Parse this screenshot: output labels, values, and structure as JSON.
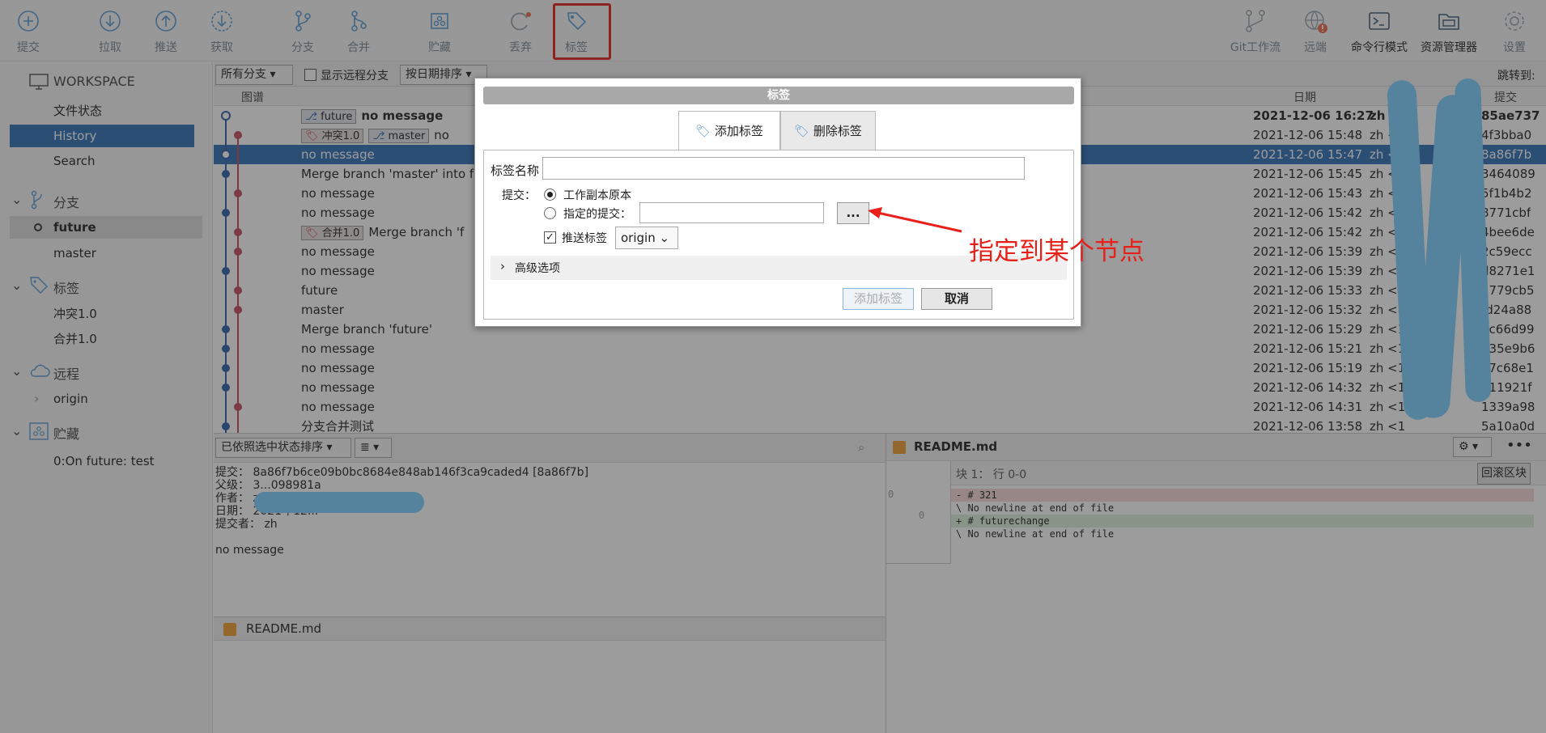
{
  "toolbar": {
    "commit": "提交",
    "pull": "拉取",
    "push": "推送",
    "fetch": "获取",
    "branch": "分支",
    "merge": "合并",
    "stash": "贮藏",
    "discard": "丢弃",
    "tag": "标签",
    "gitflow": "Git工作流",
    "remote": "远端",
    "terminal": "命令行模式",
    "explorer": "资源管理器",
    "settings": "设置"
  },
  "sidebar": {
    "workspace": "WORKSPACE",
    "workspace_items": [
      "文件状态",
      "History",
      "Search"
    ],
    "branches_header": "分支",
    "branches": [
      "future",
      "master"
    ],
    "tags_header": "标签",
    "tags": [
      "冲突1.0",
      "合并1.0"
    ],
    "remotes_header": "远程",
    "remotes": [
      "origin"
    ],
    "stash_header": "贮藏",
    "stashes": [
      "0:On future: test"
    ]
  },
  "filter": {
    "branches": "所有分支",
    "show_remote": "显示远程分支",
    "sort": "按日期排序",
    "jump": "跳转到:"
  },
  "columns": {
    "graph": "图谱",
    "date": "日期",
    "commit": "提交"
  },
  "history": [
    {
      "badges": [
        "future"
      ],
      "desc": "no message",
      "date": "2021-12-06 16:27",
      "author": "zh <",
      "hash": "85ae737",
      "bold": true
    },
    {
      "badges": [
        "冲突1.0",
        "master"
      ],
      "desc": "no",
      "date": "2021-12-06 15:48",
      "author": "zh <",
      "hash": "4f3bba0"
    },
    {
      "badges": [],
      "desc": "no message",
      "date": "2021-12-06 15:47",
      "author": "zh <",
      "hash": "8a86f7b",
      "selected": true
    },
    {
      "badges": [],
      "desc": "Merge branch 'master' into fu",
      "date": "2021-12-06 15:45",
      "author": "zh <",
      "hash": "3464089"
    },
    {
      "badges": [],
      "desc": "no message",
      "date": "2021-12-06 15:43",
      "author": "zh <",
      "hash": "5f1b4b2"
    },
    {
      "badges": [],
      "desc": "no message",
      "date": "2021-12-06 15:42",
      "author": "zh <",
      "hash": "8771cbf"
    },
    {
      "badges": [
        "合并1.0"
      ],
      "desc": "Merge branch 'f",
      "date": "2021-12-06 15:42",
      "author": "zh <",
      "hash": "4bee6de"
    },
    {
      "badges": [],
      "desc": "no message",
      "date": "2021-12-06 15:39",
      "author": "zh <",
      "hash": "2c59ecc"
    },
    {
      "badges": [],
      "desc": "no message",
      "date": "2021-12-06 15:39",
      "author": "zh <",
      "hash": "d8271e1"
    },
    {
      "badges": [],
      "desc": "future",
      "date": "2021-12-06 15:33",
      "author": "zh <",
      "hash": "1779cb5"
    },
    {
      "badges": [],
      "desc": "master",
      "date": "2021-12-06 15:32",
      "author": "zh <",
      "hash": "fd24a88"
    },
    {
      "badges": [],
      "desc": "Merge branch 'future'",
      "date": "2021-12-06 15:29",
      "author": "zh <1",
      "hash": "5c66d99"
    },
    {
      "badges": [],
      "desc": "no message",
      "date": "2021-12-06 15:21",
      "author": "zh <1",
      "hash": "635e9b6"
    },
    {
      "badges": [],
      "desc": "no message",
      "date": "2021-12-06 15:19",
      "author": "zh <1",
      "hash": "e7c68e1"
    },
    {
      "badges": [],
      "desc": "no message",
      "date": "2021-12-06 14:32",
      "author": "zh <1",
      "hash": "011921f"
    },
    {
      "badges": [],
      "desc": "no message",
      "date": "2021-12-06 14:31",
      "author": "zh <1",
      "hash": "1339a98"
    },
    {
      "badges": [],
      "desc": "分支合并测试",
      "date": "2021-12-06 13:58",
      "author": "zh <1",
      "hash": "5a10a0d"
    }
  ],
  "details": {
    "sort": "已依照选中状态排序",
    "commit_label": "提交：",
    "commit_value": "8a86f7b6ce09b0bc8684e848ab146f3ca9caded4 [8a86f7b]",
    "parent_label": "父级：",
    "parent_value": "3...098981a",
    "author_label": "作者：",
    "author_value": "z",
    "date_label": "日期：",
    "date_value": "2021年12...",
    "committer_label": "提交者：",
    "committer_value": "zh",
    "message": "no message",
    "file": "README.md"
  },
  "diff": {
    "file": "README.md",
    "hunk": "块 1： 行 0-0",
    "rollback": "回滚区块",
    "old_line": "0",
    "new_line": "0",
    "lines": [
      {
        "type": "del",
        "text": "- # 321"
      },
      {
        "type": "ctx",
        "text": "\\ No newline at end of file"
      },
      {
        "type": "add",
        "text": "+ # futurechange"
      },
      {
        "type": "ctx",
        "text": "\\ No newline at end of file"
      }
    ]
  },
  "dialog": {
    "title": "标签",
    "tab_add": "添加标签",
    "tab_remove": "删除标签",
    "name_label": "标签名称",
    "name_value": "",
    "commit_label": "提交：",
    "opt_working": "工作副本原本",
    "opt_specified": "指定的提交：",
    "specified_value": "",
    "browse": "...",
    "push_label": "推送标签",
    "remote": "origin",
    "advanced": "高级选项",
    "add_button": "添加标签",
    "cancel_button": "取消"
  },
  "annotation": "指定到某个节点",
  "colors": {
    "accent": "#2f6fb8",
    "annotation": "#e8201a",
    "redact": "#7dcfff"
  }
}
